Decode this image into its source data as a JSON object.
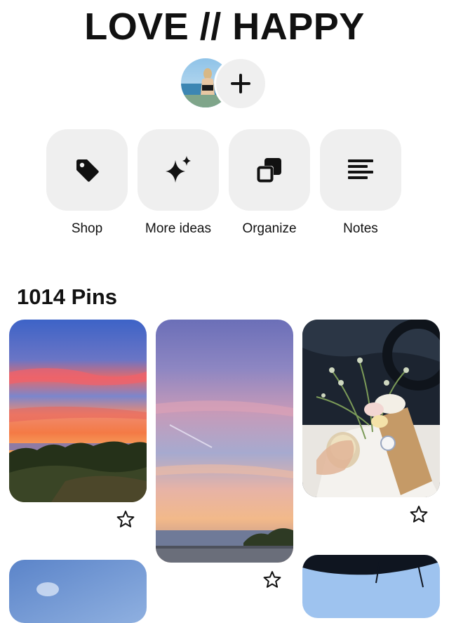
{
  "board": {
    "title": "LOVE // HAPPY",
    "pins_count_label": "1014 Pins"
  },
  "collaborators": {
    "avatar": "user-avatar",
    "add_icon": "plus-icon"
  },
  "actions": [
    {
      "label": "Shop",
      "icon": "tag-icon"
    },
    {
      "label": "More ideas",
      "icon": "sparkle-icon"
    },
    {
      "label": "Organize",
      "icon": "organize-icon"
    },
    {
      "label": "Notes",
      "icon": "notes-icon"
    }
  ],
  "pins": [
    {
      "icon": "star-icon",
      "description": "sunset over sea and bushes"
    },
    {
      "icon": "star-icon",
      "description": "pastel sunset sky over sea"
    },
    {
      "icon": "star-icon",
      "description": "flowers and drink in car"
    },
    {
      "icon": "star-icon",
      "description": "blue sky"
    },
    {
      "icon": "star-icon",
      "description": "blue sky with umbrella"
    }
  ],
  "colors": {
    "tile_bg": "#efefef",
    "text": "#111111",
    "background": "#ffffff"
  }
}
